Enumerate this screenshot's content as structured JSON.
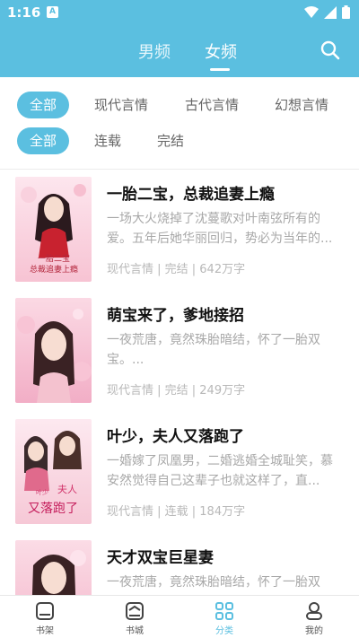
{
  "status_bar": {
    "time": "1:16",
    "notification_badge": "A"
  },
  "header": {
    "tabs": [
      {
        "label": "男频"
      },
      {
        "label": "女频"
      }
    ],
    "active_tab": "女频",
    "accent_color": "#5BBFE0"
  },
  "filters": {
    "category_row": [
      "全部",
      "现代言情",
      "古代言情",
      "幻想言情"
    ],
    "status_row": [
      "全部",
      "连载",
      "完结"
    ],
    "active_category": "全部",
    "active_status": "全部"
  },
  "books": [
    {
      "title": "一胎二宝，总裁追妻上瘾",
      "desc": "一场大火烧掉了沈蔓歌对叶南弦所有的爱。五年后她华丽回归，势必为当年的...",
      "meta": "现代言情 | 完结 | 642万字",
      "cover_text": "一胎二宝 总裁追妻上瘾"
    },
    {
      "title": "萌宝来了，爹地接招",
      "desc": "一夜荒唐，竟然珠胎暗结，怀了一胎双宝。...",
      "meta": "现代言情 | 完结 | 249万字",
      "cover_text": ""
    },
    {
      "title": "叶少，夫人又落跑了",
      "desc": "一婚嫁了凤凰男，二婚逃婚全城耻笑，慕安然觉得自己这辈子也就这样了，直...",
      "meta": "现代言情 | 连载 | 184万字",
      "cover_text": "叶少 夫人 又落跑了"
    },
    {
      "title": "天才双宝巨星妻",
      "desc": "一夜荒唐，竟然珠胎暗结，怀了一胎双宝。...",
      "meta": "",
      "cover_text": ""
    }
  ],
  "bottom_nav": [
    {
      "label": "书架",
      "icon": "bookshelf-icon"
    },
    {
      "label": "书城",
      "icon": "bookstore-icon"
    },
    {
      "label": "分类",
      "icon": "category-grid-icon",
      "active": true
    },
    {
      "label": "我的",
      "icon": "profile-icon"
    }
  ]
}
